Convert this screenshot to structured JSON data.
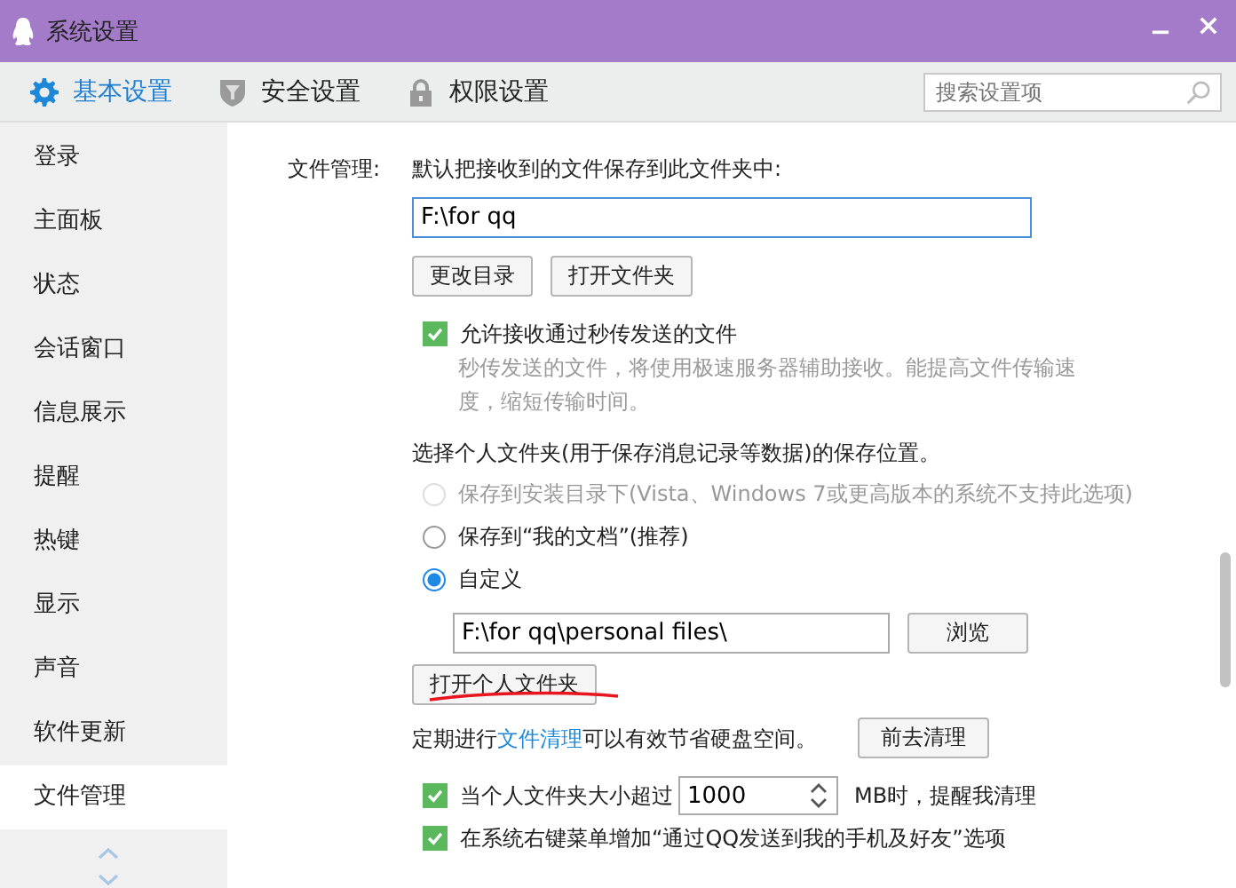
{
  "window": {
    "title": "系统设置"
  },
  "toolbar": {
    "tabs": [
      {
        "label": "基本设置",
        "selected": true
      },
      {
        "label": "安全设置",
        "selected": false
      },
      {
        "label": "权限设置",
        "selected": false
      }
    ],
    "search": {
      "placeholder": "搜索设置项"
    }
  },
  "sidebar": {
    "items": [
      {
        "label": "登录",
        "selected": false
      },
      {
        "label": "主面板",
        "selected": false
      },
      {
        "label": "状态",
        "selected": false
      },
      {
        "label": "会话窗口",
        "selected": false
      },
      {
        "label": "信息展示",
        "selected": false
      },
      {
        "label": "提醒",
        "selected": false
      },
      {
        "label": "热键",
        "selected": false
      },
      {
        "label": "显示",
        "selected": false
      },
      {
        "label": "声音",
        "selected": false
      },
      {
        "label": "软件更新",
        "selected": false
      },
      {
        "label": "文件管理",
        "selected": true
      }
    ]
  },
  "content": {
    "section_label": "文件管理:",
    "default_folder": {
      "label": "默认把接收到的文件保存到此文件夹中:",
      "value": "F:\\for qq",
      "buttons": [
        "更改目录",
        "打开文件夹"
      ]
    },
    "fast_transfer": {
      "label": "允许接收通过秒传发送的文件",
      "checked": true,
      "hint": "秒传发送的文件，将使用极速服务器辅助接收。能提高文件传输速度，缩短传输时间。"
    },
    "personal_folder": {
      "label": "选择个人文件夹(用于保存消息记录等数据)的保存位置。",
      "options": [
        {
          "label": "保存到安装目录下(Vista、Windows 7或更高版本的系统不支持此选项)",
          "selected": false,
          "disabled": true
        },
        {
          "label": "保存到“我的文档”(推荐)",
          "selected": false,
          "disabled": false
        },
        {
          "label": "自定义",
          "selected": true,
          "disabled": false
        }
      ],
      "path": "F:\\for qq\\personal files\\",
      "browse_button": "浏览",
      "open_button": "打开个人文件夹"
    },
    "cleanup": {
      "before": "定期进行",
      "link": "文件清理",
      "after": "可以有效节省硬盘空间。",
      "button": "前去清理"
    },
    "options": [
      {
        "kind": "spinner",
        "checked": true,
        "before": "当个人文件夹大小超过",
        "value": "1000",
        "after": "MB时，提醒我清理"
      },
      {
        "kind": "plain",
        "checked": true,
        "label": "在系统右键菜单增加“通过QQ发送到我的手机及好友”选项"
      }
    ]
  }
}
